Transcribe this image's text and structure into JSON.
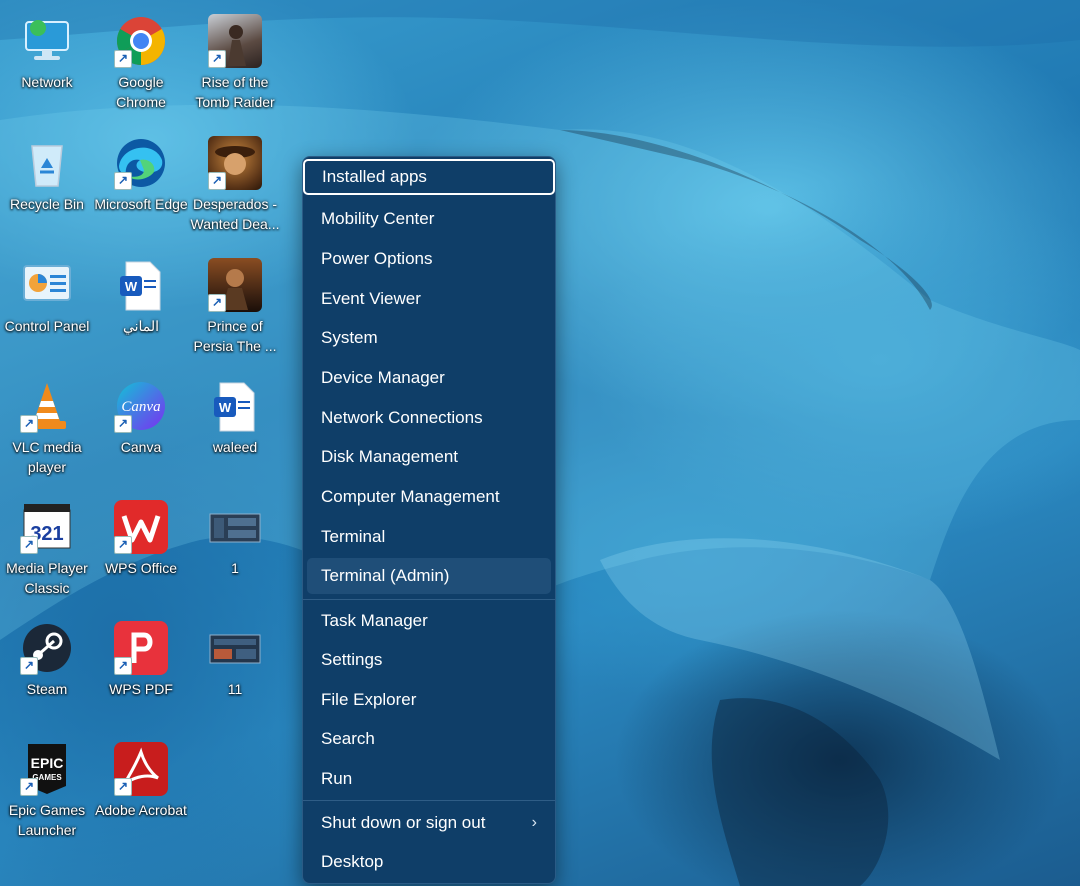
{
  "desktop": {
    "icons": [
      {
        "label": "Network",
        "icon": "network-icon"
      },
      {
        "label": "Google Chrome",
        "icon": "chrome-icon"
      },
      {
        "label": "Rise of the Tomb Raider",
        "icon": "tomb-raider-icon"
      },
      {
        "label": "Recycle Bin",
        "icon": "recycle-bin-icon"
      },
      {
        "label": "Microsoft Edge",
        "icon": "edge-icon"
      },
      {
        "label": "Desperados - Wanted Dea...",
        "icon": "desperados-icon"
      },
      {
        "label": "Control Panel",
        "icon": "control-panel-icon"
      },
      {
        "label": "الماني",
        "icon": "word-document-icon"
      },
      {
        "label": "Prince of Persia The ...",
        "icon": "prince-of-persia-icon"
      },
      {
        "label": "VLC media player",
        "icon": "vlc-icon"
      },
      {
        "label": "Canva",
        "icon": "canva-icon"
      },
      {
        "label": "waleed",
        "icon": "word-document-icon"
      },
      {
        "label": "Media Player Classic",
        "icon": "media-player-classic-icon"
      },
      {
        "label": "WPS Office",
        "icon": "wps-office-icon"
      },
      {
        "label": "1",
        "icon": "screenshot-thumbnail-icon"
      },
      {
        "label": "Steam",
        "icon": "steam-icon"
      },
      {
        "label": "WPS PDF",
        "icon": "wps-pdf-icon"
      },
      {
        "label": "11",
        "icon": "screenshot-thumbnail-icon"
      },
      {
        "label": "Epic Games Launcher",
        "icon": "epic-games-icon"
      },
      {
        "label": "Adobe Acrobat",
        "icon": "adobe-acrobat-icon"
      }
    ]
  },
  "menu": {
    "items": [
      {
        "label": "Installed apps",
        "state": "focused"
      },
      {
        "label": "Mobility Center"
      },
      {
        "label": "Power Options"
      },
      {
        "label": "Event Viewer"
      },
      {
        "label": "System"
      },
      {
        "label": "Device Manager"
      },
      {
        "label": "Network Connections"
      },
      {
        "label": "Disk Management"
      },
      {
        "label": "Computer Management"
      },
      {
        "label": "Terminal"
      },
      {
        "label": "Terminal (Admin)",
        "state": "hover"
      },
      {
        "label": "Task Manager"
      },
      {
        "label": "Settings"
      },
      {
        "label": "File Explorer"
      },
      {
        "label": "Search"
      },
      {
        "label": "Run"
      },
      {
        "label": "Shut down or sign out",
        "submenu": "chevron-right-icon"
      },
      {
        "label": "Desktop"
      }
    ],
    "chevron": "›"
  },
  "colors": {
    "menu_bg": "#0f3e68",
    "menu_text": "#ffffff",
    "hover_bg": "#1f4e78"
  }
}
